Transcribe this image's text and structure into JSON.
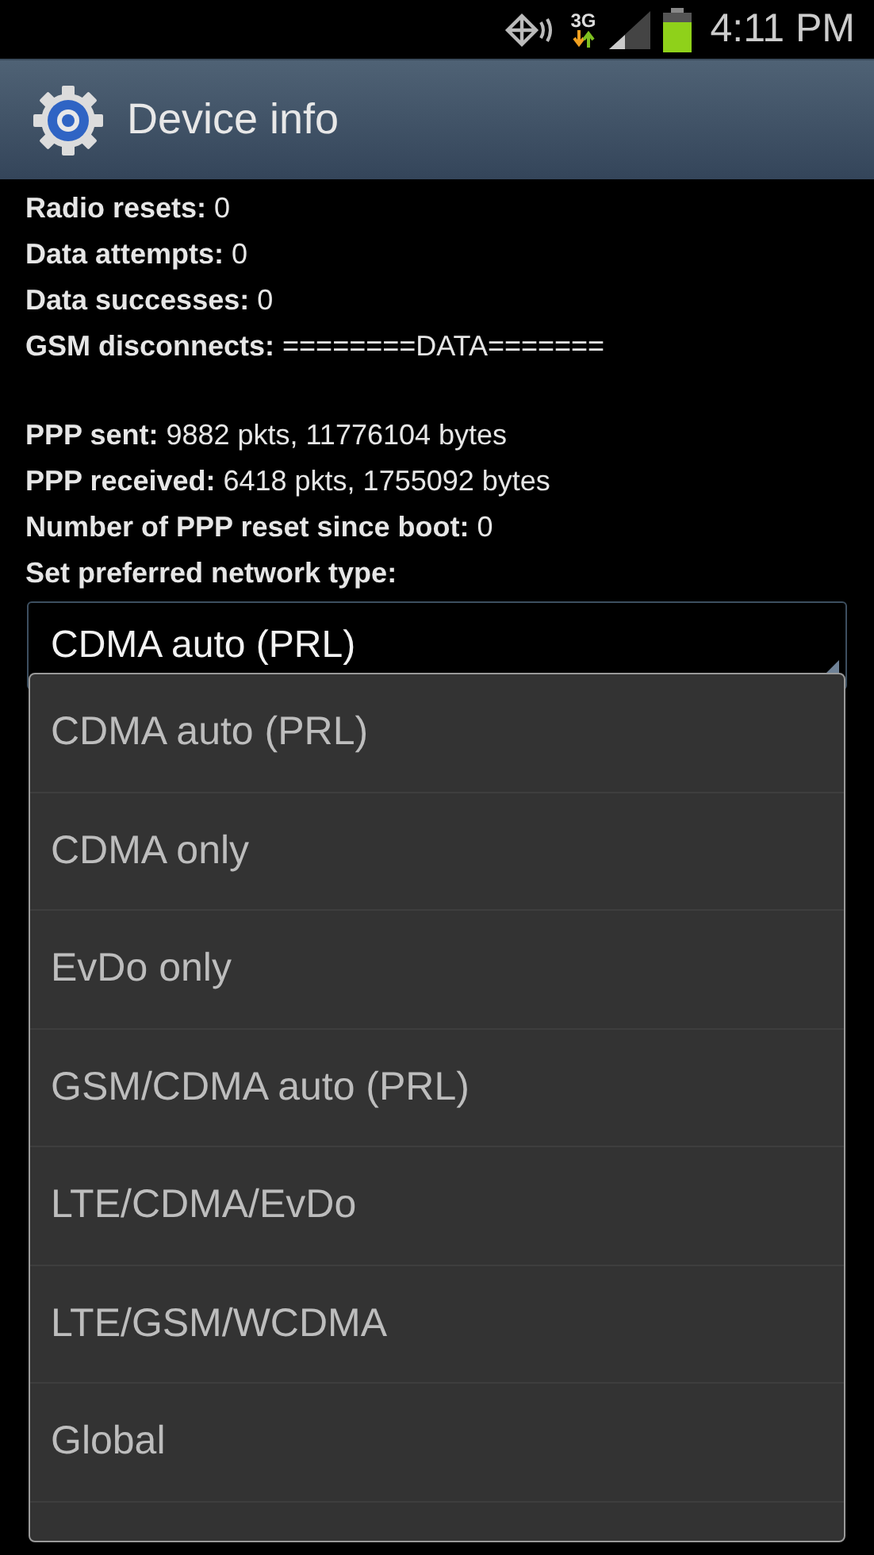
{
  "status_bar": {
    "network_type": "3G",
    "time": "4:11 PM"
  },
  "header": {
    "title": "Device info"
  },
  "info_groups": [
    [
      {
        "label": "Radio resets:",
        "value": "0"
      },
      {
        "label": "Data attempts:",
        "value": "0"
      },
      {
        "label": "Data successes:",
        "value": "0"
      },
      {
        "label": "GSM disconnects:",
        "value": "========DATA======="
      }
    ],
    [
      {
        "label": "PPP sent:",
        "value": "9882 pkts, 11776104 bytes"
      },
      {
        "label": "PPP received:",
        "value": "6418 pkts, 1755092 bytes"
      },
      {
        "label": "Number of PPP reset since boot:",
        "value": "0"
      },
      {
        "label": "Set preferred network type:"
      }
    ]
  ],
  "spinner": {
    "value": "CDMA auto (PRL)"
  },
  "dropdown": {
    "options": [
      "CDMA auto (PRL)",
      "CDMA only",
      "EvDo only",
      "GSM/CDMA auto (PRL)",
      "LTE/CDMA/EvDo",
      "LTE/GSM/WCDMA",
      "Global"
    ]
  }
}
